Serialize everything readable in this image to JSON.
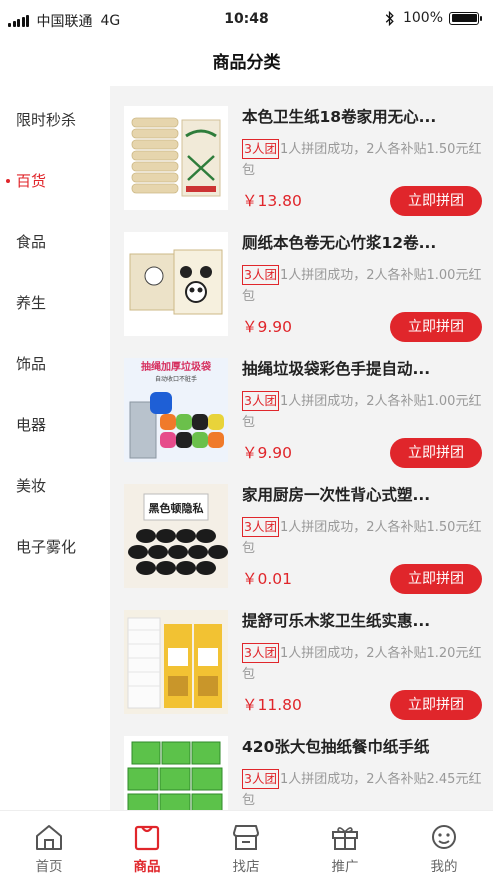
{
  "status_bar": {
    "carrier": "中国联通",
    "network": "4G",
    "time": "10:48",
    "battery": "100%"
  },
  "header": {
    "title": "商品分类"
  },
  "sidebar": {
    "items": [
      {
        "label": "限时秒杀"
      },
      {
        "label": "百货",
        "active": true
      },
      {
        "label": "食品"
      },
      {
        "label": "养生"
      },
      {
        "label": "饰品"
      },
      {
        "label": "电器"
      },
      {
        "label": "美妆"
      },
      {
        "label": "电子雾化"
      }
    ]
  },
  "products": [
    {
      "name": "本色卫生纸18卷家用无心...",
      "badge": "3人团",
      "desc": "1人拼团成功，2人各补贴1.50元红包",
      "price": "￥13.80",
      "button": "立即拼团",
      "image": "toilet-paper-rolls"
    },
    {
      "name": "厕纸本色卷无心竹浆12卷...",
      "badge": "3人团",
      "desc": "1人拼团成功，2人各补贴1.00元红包",
      "price": "￥9.90",
      "button": "立即拼团",
      "image": "panda-toilet-paper"
    },
    {
      "name": "抽绳垃圾袋彩色手提自动...",
      "badge": "3人团",
      "desc": "1人拼团成功，2人各补贴1.00元红包",
      "price": "￥9.90",
      "button": "立即拼团",
      "image": "colored-garbage-bags",
      "image_text": {
        "title": "抽绳加厚垃圾袋",
        "subtitle": "自动收口不脏手"
      }
    },
    {
      "name": "家用厨房一次性背心式塑...",
      "badge": "3人团",
      "desc": "1人拼团成功，2人各补贴1.50元红包",
      "price": "￥0.01",
      "button": "立即拼团",
      "image": "black-plastic-bags",
      "image_text": {
        "title": "黑色顿隐私"
      }
    },
    {
      "name": "提舒可乐木浆卫生纸实惠...",
      "badge": "3人团",
      "desc": "1人拼团成功，2人各补贴1.20元红包",
      "price": "￥11.80",
      "button": "立即拼团",
      "image": "yellow-pack-toilet-paper"
    },
    {
      "name": "420张大包抽纸餐巾纸手纸",
      "badge": "3人团",
      "desc": "1人拼团成功，2人各补贴2.45元红包",
      "price": "",
      "button": "",
      "image": "green-tissue-packs"
    }
  ],
  "tabbar": {
    "items": [
      {
        "label": "首页",
        "icon": "home-icon"
      },
      {
        "label": "商品",
        "icon": "bag-icon",
        "active": true
      },
      {
        "label": "找店",
        "icon": "store-icon"
      },
      {
        "label": "推广",
        "icon": "gift-icon"
      },
      {
        "label": "我的",
        "icon": "user-icon"
      }
    ]
  },
  "colors": {
    "accent": "#e0262b",
    "content_bg": "#f3f3f3"
  }
}
